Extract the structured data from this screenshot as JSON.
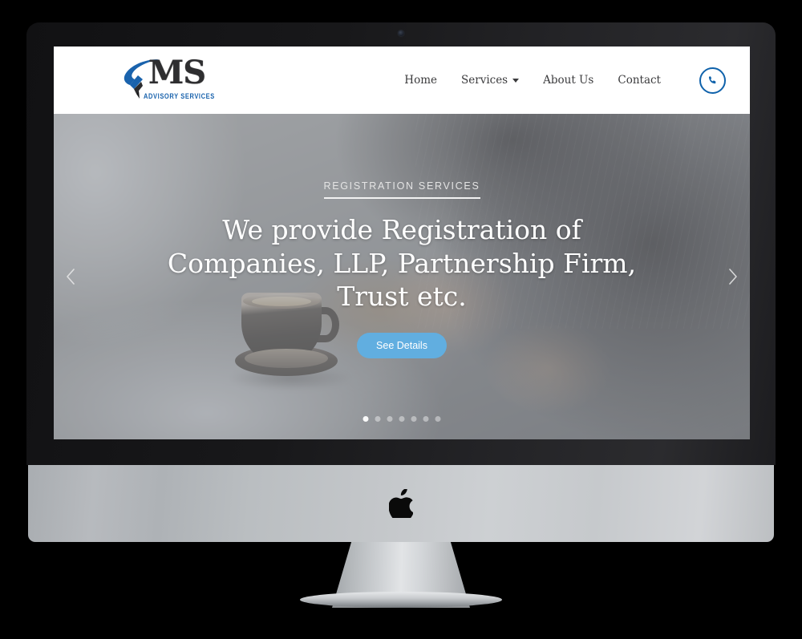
{
  "device": {
    "type": "imac-desktop-mockup",
    "brand_logo": "apple-logo",
    "webcam": "webcam-dot"
  },
  "site": {
    "logo": {
      "mark": "ms-monogram-with-pen-nib",
      "text": "MS",
      "tagline": "ADVISORY SERVICES",
      "tagline_color": "#1a63ad"
    },
    "nav": {
      "items": [
        {
          "label": "Home",
          "has_dropdown": false
        },
        {
          "label": "Services",
          "has_dropdown": true
        },
        {
          "label": "About Us",
          "has_dropdown": false
        },
        {
          "label": "Contact",
          "has_dropdown": false
        }
      ],
      "phone_button": {
        "icon": "phone-icon",
        "color": "#0f62ab"
      }
    },
    "hero": {
      "eyebrow": "REGISTRATION SERVICES",
      "title": "We provide Registration of Companies, LLP, Partnership Firm, Trust etc.",
      "button_label": "See Details",
      "button_color": "#61aee0",
      "prev_icon": "chevron-left-icon",
      "next_icon": "chevron-right-icon",
      "slide_count": 7,
      "active_slide": 1,
      "background_description": "desk-with-coffee-cup-notebook-and-person-using-tablet"
    }
  }
}
